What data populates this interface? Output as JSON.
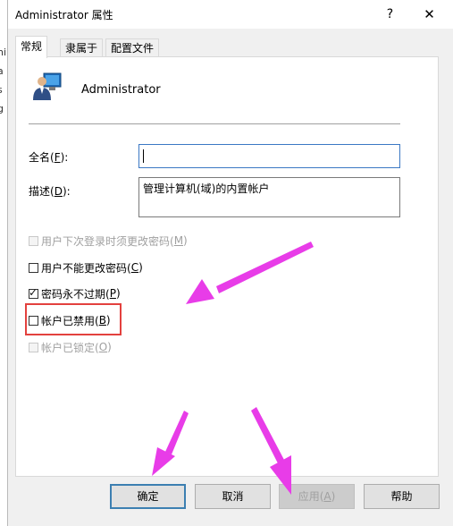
{
  "background_window": {
    "fragments": [
      "ni",
      "a",
      "s",
      "g"
    ]
  },
  "window": {
    "title": "Administrator 属性",
    "help_glyph": "?",
    "close_glyph": "✕"
  },
  "tabs": [
    {
      "label": "常规",
      "active": true
    },
    {
      "label": "隶属于",
      "active": false
    },
    {
      "label": "配置文件",
      "active": false
    }
  ],
  "user": {
    "name": "Administrator",
    "icon": "user-account-icon"
  },
  "fields": {
    "fullname": {
      "label": "全名(",
      "key": "F",
      "label_end": "):",
      "value": ""
    },
    "description": {
      "label": "描述(",
      "key": "D",
      "label_end": "):",
      "value": "管理计算机(域)的内置帐户"
    }
  },
  "checkboxes": [
    {
      "label": "用户下次登录时须更改密码(",
      "key": "M",
      "label_end": ")",
      "checked": false,
      "enabled": false
    },
    {
      "label": "用户不能更改密码(",
      "key": "C",
      "label_end": ")",
      "checked": false,
      "enabled": true
    },
    {
      "label": "密码永不过期(",
      "key": "P",
      "label_end": ")",
      "checked": true,
      "enabled": true
    },
    {
      "label": "帐户已禁用(",
      "key": "B",
      "label_end": ")",
      "checked": false,
      "enabled": true
    },
    {
      "label": "帐户已锁定(",
      "key": "O",
      "label_end": ")",
      "checked": false,
      "enabled": false
    }
  ],
  "buttons": {
    "ok": "确定",
    "cancel": "取消",
    "apply": {
      "label": "应用(",
      "key": "A",
      "label_end": ")"
    },
    "help": "帮助"
  },
  "annotation": {
    "highlight_color": "#e3413e",
    "arrow_color": "#e83ce8"
  }
}
